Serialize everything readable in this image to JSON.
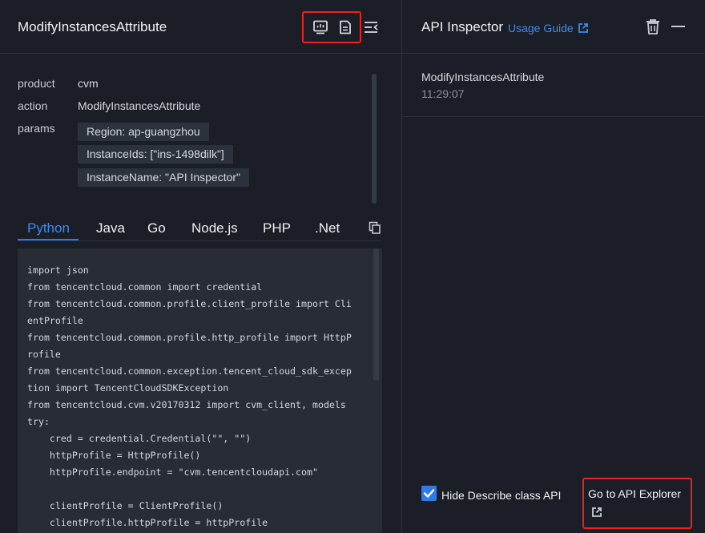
{
  "left": {
    "title": "ModifyInstancesAttribute",
    "icons": [
      "monitor-icon",
      "document-icon",
      "collapse-panel-icon"
    ],
    "params": {
      "product_label": "product",
      "product_value": "cvm",
      "action_label": "action",
      "action_value": "ModifyInstancesAttribute",
      "params_label": "params",
      "items": [
        "Region: ap-guangzhou",
        "InstanceIds: [\"ins-1498dilk\"]",
        "InstanceName: \"API Inspector\""
      ]
    },
    "tabs": [
      "Python",
      "Java",
      "Go",
      "Node.js",
      "PHP",
      ".Net"
    ],
    "active_tab": "Python",
    "code": "import json\nfrom tencentcloud.common import credential\nfrom tencentcloud.common.profile.client_profile import Cli\nentProfile\nfrom tencentcloud.common.profile.http_profile import HttpP\nrofile\nfrom tencentcloud.common.exception.tencent_cloud_sdk_excep\ntion import TencentCloudSDKException\nfrom tencentcloud.cvm.v20170312 import cvm_client, models\ntry:\n    cred = credential.Credential(\"\", \"\")\n    httpProfile = HttpProfile()\n    httpProfile.endpoint = \"cvm.tencentcloudapi.com\"\n\n    clientProfile = ClientProfile()\n    clientProfile.httpProfile = httpProfile"
  },
  "right": {
    "title": "API Inspector",
    "usage_guide": "Usage Guide",
    "entry": {
      "name": "ModifyInstancesAttribute",
      "time": "11:29:07"
    },
    "hide_describe_label": "Hide Describe class API",
    "hide_describe_checked": true,
    "explorer_link": "Go to API Explorer"
  },
  "colors": {
    "background": "#1b1e26",
    "accent": "#2f7ce9",
    "highlight_box": "#f0201f",
    "code_background": "#272c35"
  }
}
